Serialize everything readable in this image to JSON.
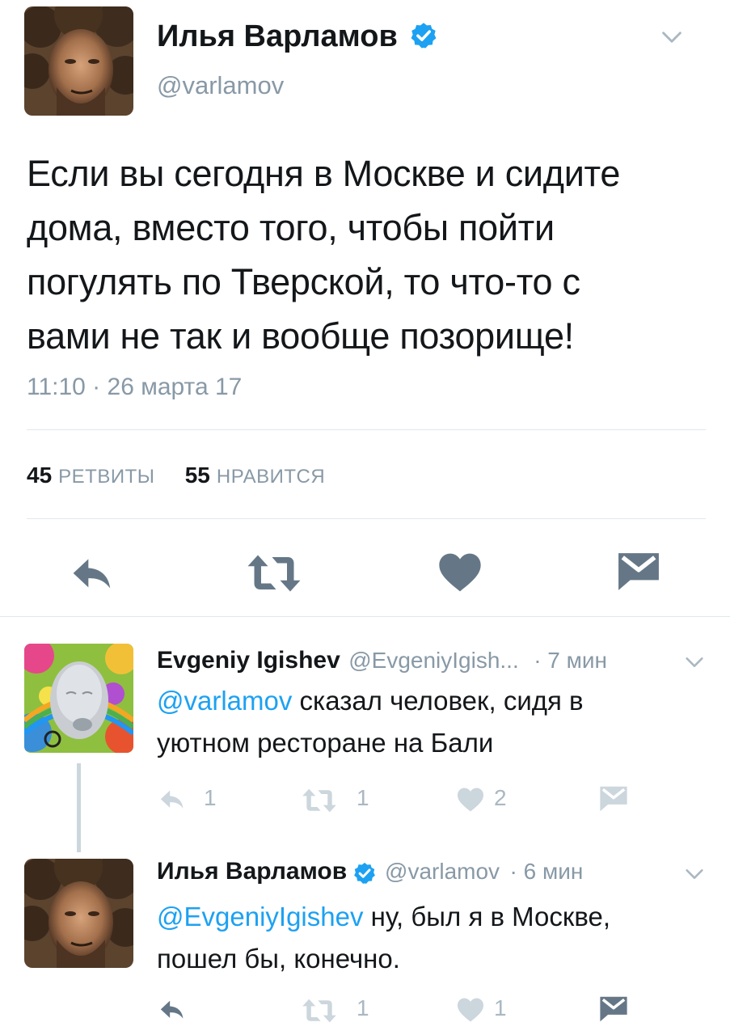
{
  "colors": {
    "text": "#14171a",
    "muted": "#8899a6",
    "accent": "#1da1f2",
    "icon_dark": "#657786",
    "icon_light": "#ccd6dd",
    "divider": "#e1e8ed"
  },
  "tweet": {
    "author_name": "Илья Варламов",
    "author_handle": "@varlamov",
    "verified": true,
    "text_lines": [
      "Если вы сегодня в Москве и сидите",
      "дома, вместо того, чтобы пойти",
      "погулять по Тверской, то что-то с",
      "вами не так и вообще позорище!"
    ],
    "timestamp": "11:10 · 26 марта 17",
    "retweets_count": "45",
    "retweets_label": "РЕТВИТЫ",
    "likes_count": "55",
    "likes_label": "НРАВИТСЯ",
    "actions": [
      "reply-icon",
      "retweet-icon",
      "heart-icon",
      "dm-icon"
    ]
  },
  "replies": [
    {
      "author_name": "Evgeniy Igishev",
      "author_handle": "@EvgeniyIgish...",
      "time": "· 7 мин",
      "verified": false,
      "mention": "@varlamov",
      "text_line1": " сказал человек, сидя в",
      "text_line2": "уютном ресторане на Бали",
      "reply_count": "1",
      "retweet_count": "1",
      "like_count": "2"
    },
    {
      "author_name": "Илья Варламов",
      "author_handle": "@varlamov",
      "time": "· 6 мин",
      "verified": true,
      "mention": "@EvgeniyIgishev",
      "text_line1": " ну, был я в Москве,",
      "text_line2": "пошел бы, конечно.",
      "reply_count": "",
      "retweet_count": "1",
      "like_count": "1"
    }
  ]
}
